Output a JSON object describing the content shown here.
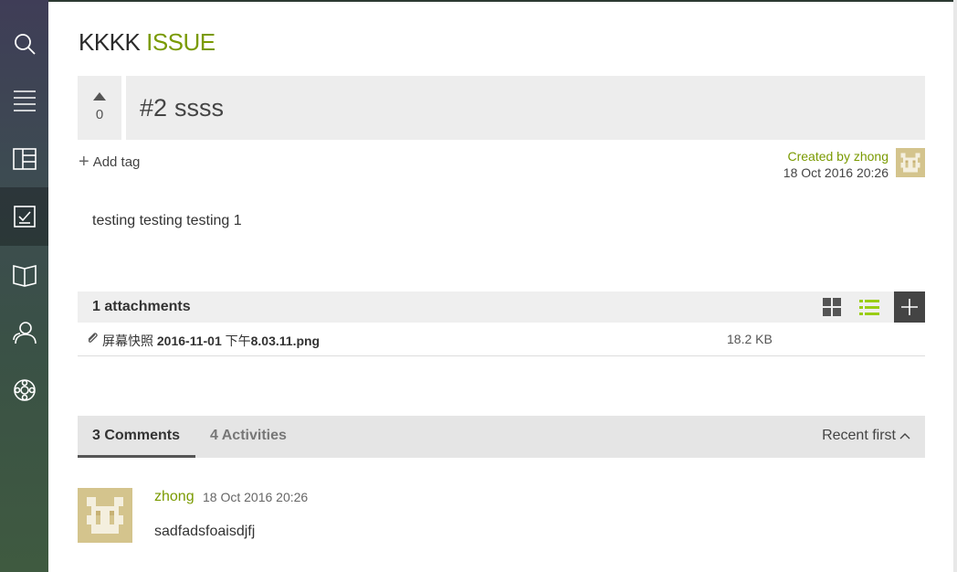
{
  "sidebar": {
    "items": [
      {
        "icon": "search-icon"
      },
      {
        "icon": "menu-icon"
      },
      {
        "icon": "board-icon"
      },
      {
        "icon": "checklist-icon",
        "active": true
      },
      {
        "icon": "book-icon"
      },
      {
        "icon": "team-icon"
      },
      {
        "icon": "settings-icon"
      }
    ]
  },
  "header": {
    "project": "KKKK",
    "kind": "ISSUE"
  },
  "issue": {
    "votes": "0",
    "ref": "#2",
    "subject": "ssss",
    "add_tag": "Add tag",
    "created_by": "Created by zhong",
    "created_date": "18 Oct 2016 20:26",
    "description": "testing testing testing 1"
  },
  "attachments": {
    "title": "1 attachments",
    "files": [
      {
        "name_prefix": "屏幕快照 ",
        "name_bold": "2016-11-01",
        "name_mid": " 下午",
        "name_bold2": "8.03.11.png",
        "size": "18.2 KB"
      }
    ]
  },
  "tabs": {
    "comments": "3 Comments",
    "activities": "4 Activities",
    "sort": "Recent first"
  },
  "comments": [
    {
      "author": "zhong",
      "date": "18 Oct 2016 20:26",
      "text": "sadfadsfoaisdjfj"
    }
  ],
  "colors": {
    "accent": "#7a9a01",
    "list_icon": "#9acd14",
    "sidebar_active": "#2f3d3a"
  }
}
